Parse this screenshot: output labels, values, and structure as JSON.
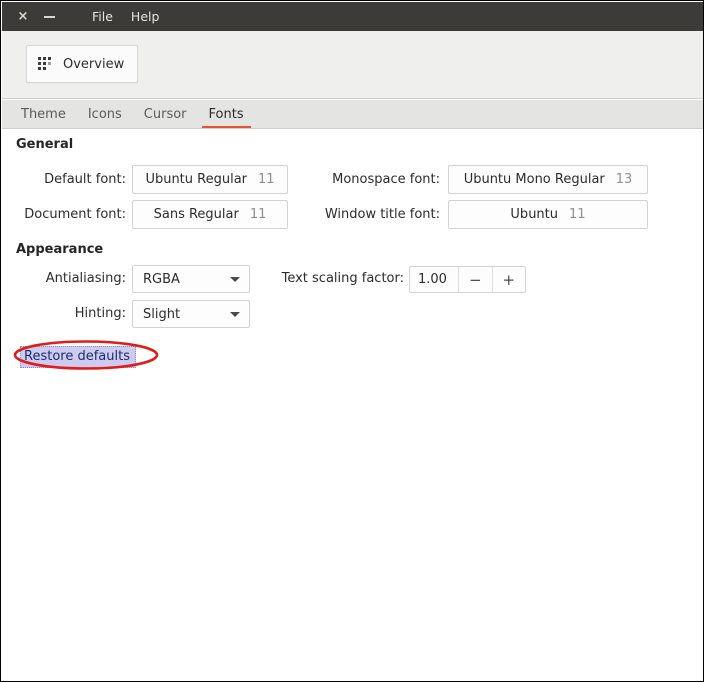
{
  "window": {
    "titlebar": {
      "close_label": "×",
      "minimize_label": "−",
      "menus": [
        {
          "label": "File"
        },
        {
          "label": "Help"
        }
      ]
    },
    "toolbar": {
      "overview_label": "Overview",
      "overview_icon": "grid-dots-icon"
    },
    "tabs": [
      {
        "label": "Theme",
        "active": false
      },
      {
        "label": "Icons",
        "active": false
      },
      {
        "label": "Cursor",
        "active": false
      },
      {
        "label": "Fonts",
        "active": true
      }
    ]
  },
  "sections": {
    "general": {
      "title": "General",
      "fields": [
        {
          "label": "Default font:",
          "value": "Ubuntu Regular",
          "size": "11"
        },
        {
          "label": "Monospace font:",
          "value": "Ubuntu Mono Regular",
          "size": "13"
        },
        {
          "label": "Document font:",
          "value": "Sans Regular",
          "size": "11"
        },
        {
          "label": "Window title font:",
          "value": "Ubuntu",
          "size": "11"
        }
      ]
    },
    "appearance": {
      "title": "Appearance",
      "antialiasing": {
        "label": "Antialiasing:",
        "value": "RGBA"
      },
      "hinting": {
        "label": "Hinting:",
        "value": "Slight"
      },
      "text_scaling": {
        "label": "Text scaling factor:",
        "value": "1.00",
        "decrement_label": "−",
        "increment_label": "+"
      }
    },
    "restore_defaults": {
      "label": "Restore defaults"
    }
  },
  "colors": {
    "accent": "#e8542a",
    "titlebar_bg": "#3c3b37",
    "annotation": "#e01b1b",
    "selection_bg": "#cdcbef",
    "selection_fg": "#1b2e6b"
  }
}
